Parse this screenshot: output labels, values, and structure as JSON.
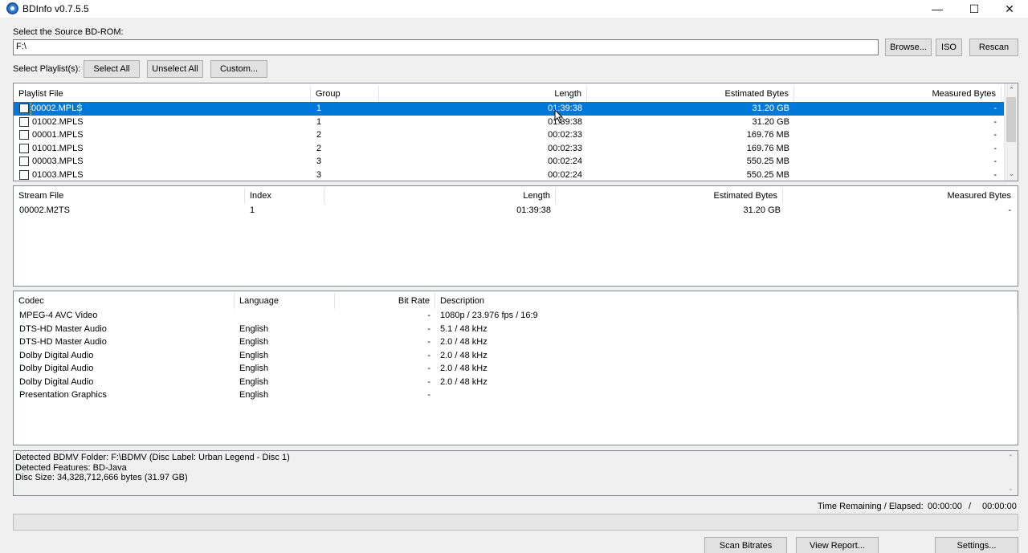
{
  "window": {
    "title": "BDInfo v0.7.5.5",
    "controls": {
      "minimize": "—",
      "maximize": "☐",
      "close": "✕"
    }
  },
  "source": {
    "label": "Select the Source BD-ROM:",
    "value": "F:\\",
    "browse_label": "Browse...",
    "iso_label": "ISO",
    "rescan_label": "Rescan"
  },
  "playlist_controls": {
    "label": "Select Playlist(s):",
    "select_all": "Select All",
    "unselect_all": "Unselect All",
    "custom": "Custom..."
  },
  "playlists": {
    "headers": [
      "Playlist File",
      "Group",
      "Length",
      "Estimated Bytes",
      "Measured Bytes"
    ],
    "rows": [
      {
        "file": "00002.MPLS",
        "group": "1",
        "length": "01:39:38",
        "estimated": "31.20 GB",
        "measured": "-",
        "selected": true
      },
      {
        "file": "01002.MPLS",
        "group": "1",
        "length": "01:39:38",
        "estimated": "31.20 GB",
        "measured": "-",
        "selected": false
      },
      {
        "file": "00001.MPLS",
        "group": "2",
        "length": "00:02:33",
        "estimated": "169.76 MB",
        "measured": "-",
        "selected": false
      },
      {
        "file": "01001.MPLS",
        "group": "2",
        "length": "00:02:33",
        "estimated": "169.76 MB",
        "measured": "-",
        "selected": false
      },
      {
        "file": "00003.MPLS",
        "group": "3",
        "length": "00:02:24",
        "estimated": "550.25 MB",
        "measured": "-",
        "selected": false
      },
      {
        "file": "01003.MPLS",
        "group": "3",
        "length": "00:02:24",
        "estimated": "550.25 MB",
        "measured": "-",
        "selected": false
      }
    ]
  },
  "streams": {
    "headers": [
      "Stream File",
      "Index",
      "Length",
      "Estimated Bytes",
      "Measured Bytes"
    ],
    "rows": [
      {
        "file": "00002.M2TS",
        "index": "1",
        "length": "01:39:38",
        "estimated": "31.20 GB",
        "measured": "-"
      }
    ]
  },
  "codecs": {
    "headers": [
      "Codec",
      "Language",
      "Bit Rate",
      "Description"
    ],
    "rows": [
      {
        "codec": "MPEG-4 AVC Video",
        "language": "",
        "bitrate": "-",
        "description": "1080p / 23.976 fps / 16:9"
      },
      {
        "codec": "DTS-HD Master Audio",
        "language": "English",
        "bitrate": "-",
        "description": "5.1 / 48 kHz"
      },
      {
        "codec": "DTS-HD Master Audio",
        "language": "English",
        "bitrate": "-",
        "description": "2.0 / 48 kHz"
      },
      {
        "codec": "Dolby Digital Audio",
        "language": "English",
        "bitrate": "-",
        "description": "2.0 / 48 kHz"
      },
      {
        "codec": "Dolby Digital Audio",
        "language": "English",
        "bitrate": "-",
        "description": "2.0 / 48 kHz"
      },
      {
        "codec": "Dolby Digital Audio",
        "language": "English",
        "bitrate": "-",
        "description": "2.0 / 48 kHz"
      },
      {
        "codec": "Presentation Graphics",
        "language": "English",
        "bitrate": "-",
        "description": ""
      }
    ]
  },
  "report": {
    "lines": [
      "Detected BDMV Folder: F:\\BDMV (Disc Label: Urban Legend - Disc 1)",
      "Detected Features: BD-Java",
      "Disc Size: 34,328,712,666 bytes (31.97 GB)"
    ]
  },
  "status": {
    "label": "Time Remaining / Elapsed:",
    "remaining": "00:00:00",
    "separator": "/",
    "elapsed": "00:00:00",
    "progress": 0
  },
  "footer": {
    "scan_bitrates": "Scan Bitrates",
    "view_report": "View Report...",
    "settings": "Settings..."
  }
}
